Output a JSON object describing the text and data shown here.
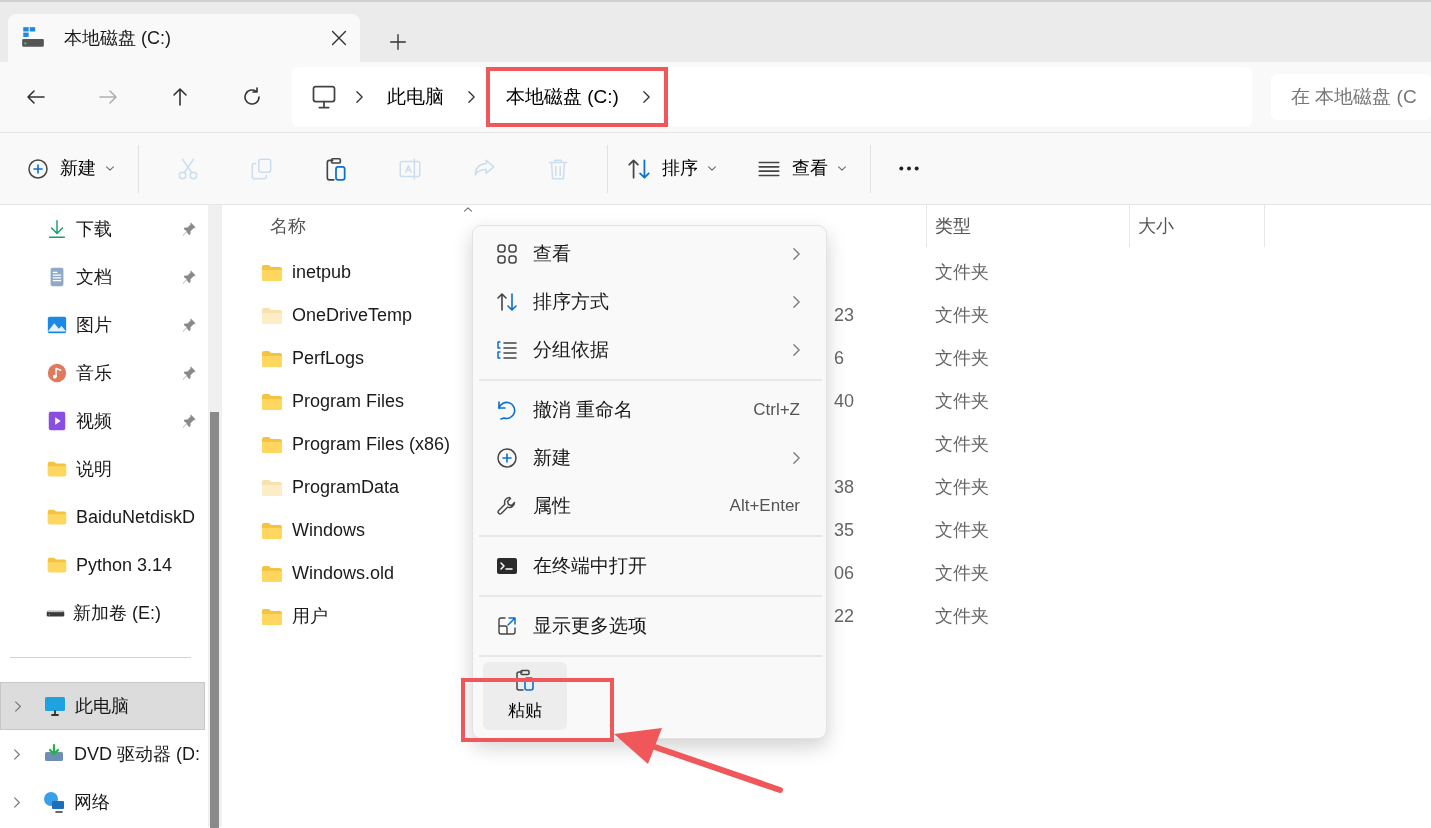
{
  "tab": {
    "title": "本地磁盘 (C:)"
  },
  "nav_buttons": [
    {
      "kind": "back",
      "disabled": false
    },
    {
      "kind": "forward",
      "disabled": true
    },
    {
      "kind": "up",
      "disabled": false
    },
    {
      "kind": "refresh",
      "disabled": false
    }
  ],
  "breadcrumb": [
    {
      "label": "此电脑",
      "highlighted": false
    },
    {
      "label": "本地磁盘 (C:)",
      "highlighted": true
    }
  ],
  "search": {
    "placeholder": "在 本地磁盘 (C"
  },
  "command_bar": {
    "new_label": "新建",
    "sort_label": "排序",
    "view_label": "查看",
    "tools": [
      {
        "kind": "cut",
        "disabled": true
      },
      {
        "kind": "copy",
        "disabled": true
      },
      {
        "kind": "paste",
        "disabled": false
      },
      {
        "kind": "rename",
        "disabled": true
      },
      {
        "kind": "share",
        "disabled": true
      },
      {
        "kind": "delete",
        "disabled": true
      }
    ]
  },
  "sidebar": {
    "quick_access": [
      {
        "label": "下载",
        "kind": "download",
        "pinned": true
      },
      {
        "label": "文档",
        "kind": "document",
        "pinned": true
      },
      {
        "label": "图片",
        "kind": "picture",
        "pinned": true
      },
      {
        "label": "音乐",
        "kind": "music",
        "pinned": true
      },
      {
        "label": "视频",
        "kind": "video",
        "pinned": true
      },
      {
        "label": "说明",
        "kind": "folder",
        "pinned": false
      },
      {
        "label": "BaiduNetdiskD",
        "kind": "folder",
        "pinned": false
      },
      {
        "label": "Python 3.14",
        "kind": "folder",
        "pinned": false
      },
      {
        "label": "新加卷 (E:)",
        "kind": "drive",
        "pinned": false
      }
    ],
    "locations": [
      {
        "label": "此电脑",
        "kind": "computer",
        "selected": true
      },
      {
        "label": "DVD 驱动器 (D:",
        "kind": "dvd",
        "selected": false
      },
      {
        "label": "网络",
        "kind": "network",
        "selected": false
      }
    ]
  },
  "table": {
    "columns": [
      "名称",
      "类型",
      "大小"
    ],
    "rows": [
      {
        "name": "inetpub",
        "hidden": false,
        "type": "文件夹"
      },
      {
        "name": "OneDriveTemp",
        "hidden": true,
        "modified": "23",
        "type": "文件夹"
      },
      {
        "name": "PerfLogs",
        "hidden": false,
        "modified": "6",
        "type": "文件夹"
      },
      {
        "name": "Program Files",
        "hidden": false,
        "modified": "40",
        "type": "文件夹"
      },
      {
        "name": "Program Files (x86)",
        "hidden": false,
        "type": "文件夹"
      },
      {
        "name": "ProgramData",
        "hidden": true,
        "modified": "38",
        "type": "文件夹"
      },
      {
        "name": "Windows",
        "hidden": false,
        "modified": "35",
        "type": "文件夹"
      },
      {
        "name": "Windows.old",
        "hidden": false,
        "modified": "06",
        "type": "文件夹"
      },
      {
        "name": "用户",
        "hidden": false,
        "modified": "22",
        "type": "文件夹"
      }
    ]
  },
  "context_menu": {
    "items": [
      {
        "kind": "view",
        "label": "查看",
        "submenu": true
      },
      {
        "kind": "sort",
        "label": "排序方式",
        "submenu": true
      },
      {
        "kind": "group",
        "label": "分组依据",
        "submenu": true
      },
      {
        "kind": "separator"
      },
      {
        "kind": "undo",
        "label": "撤消 重命名",
        "shortcut": "Ctrl+Z",
        "submenu": false
      },
      {
        "kind": "new",
        "label": "新建",
        "submenu": true
      },
      {
        "kind": "properties",
        "label": "属性",
        "shortcut": "Alt+Enter",
        "submenu": false
      },
      {
        "kind": "separator"
      },
      {
        "kind": "terminal",
        "label": "在终端中打开",
        "submenu": false
      },
      {
        "kind": "separator"
      },
      {
        "kind": "more_options",
        "label": "显示更多选项",
        "submenu": false
      },
      {
        "kind": "separator"
      }
    ],
    "quick_actions": [
      {
        "label": "粘贴",
        "highlighted": true
      }
    ]
  },
  "annotations": [
    {
      "kind": "arrow"
    }
  ]
}
